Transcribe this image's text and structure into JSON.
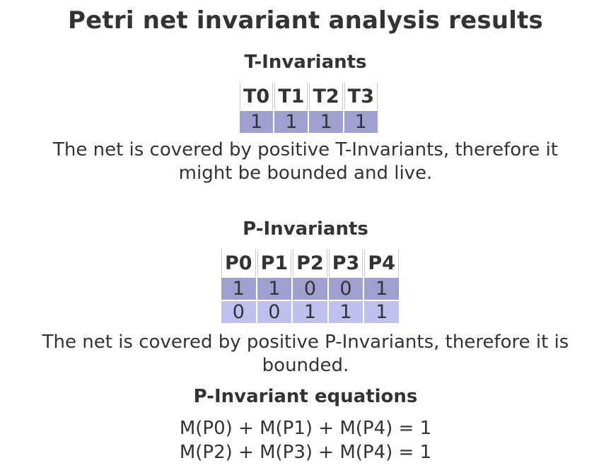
{
  "title": "Petri net invariant analysis results",
  "t_invariants": {
    "heading": "T-Invariants",
    "columns": [
      "T0",
      "T1",
      "T2",
      "T3"
    ],
    "rows": [
      [
        "1",
        "1",
        "1",
        "1"
      ]
    ],
    "summary_line1": "The net is covered by positive T-Invariants, therefore it",
    "summary_line2": "might be bounded and live."
  },
  "p_invariants": {
    "heading": "P-Invariants",
    "columns": [
      "P0",
      "P1",
      "P2",
      "P3",
      "P4"
    ],
    "rows": [
      [
        "1",
        "1",
        "0",
        "0",
        "1"
      ],
      [
        "0",
        "0",
        "1",
        "1",
        "1"
      ]
    ],
    "summary_line1": "The net is covered by positive P-Invariants, therefore it is",
    "summary_line2": "bounded."
  },
  "equations": {
    "heading": "P-Invariant equations",
    "lines": [
      "M(P0) + M(P1) + M(P4) = 1",
      "M(P2) + M(P3) + M(P4) = 1"
    ]
  },
  "colors": {
    "text": "#333333",
    "row_dark": "#a0a0d0",
    "row_light": "#c0c0ee"
  }
}
